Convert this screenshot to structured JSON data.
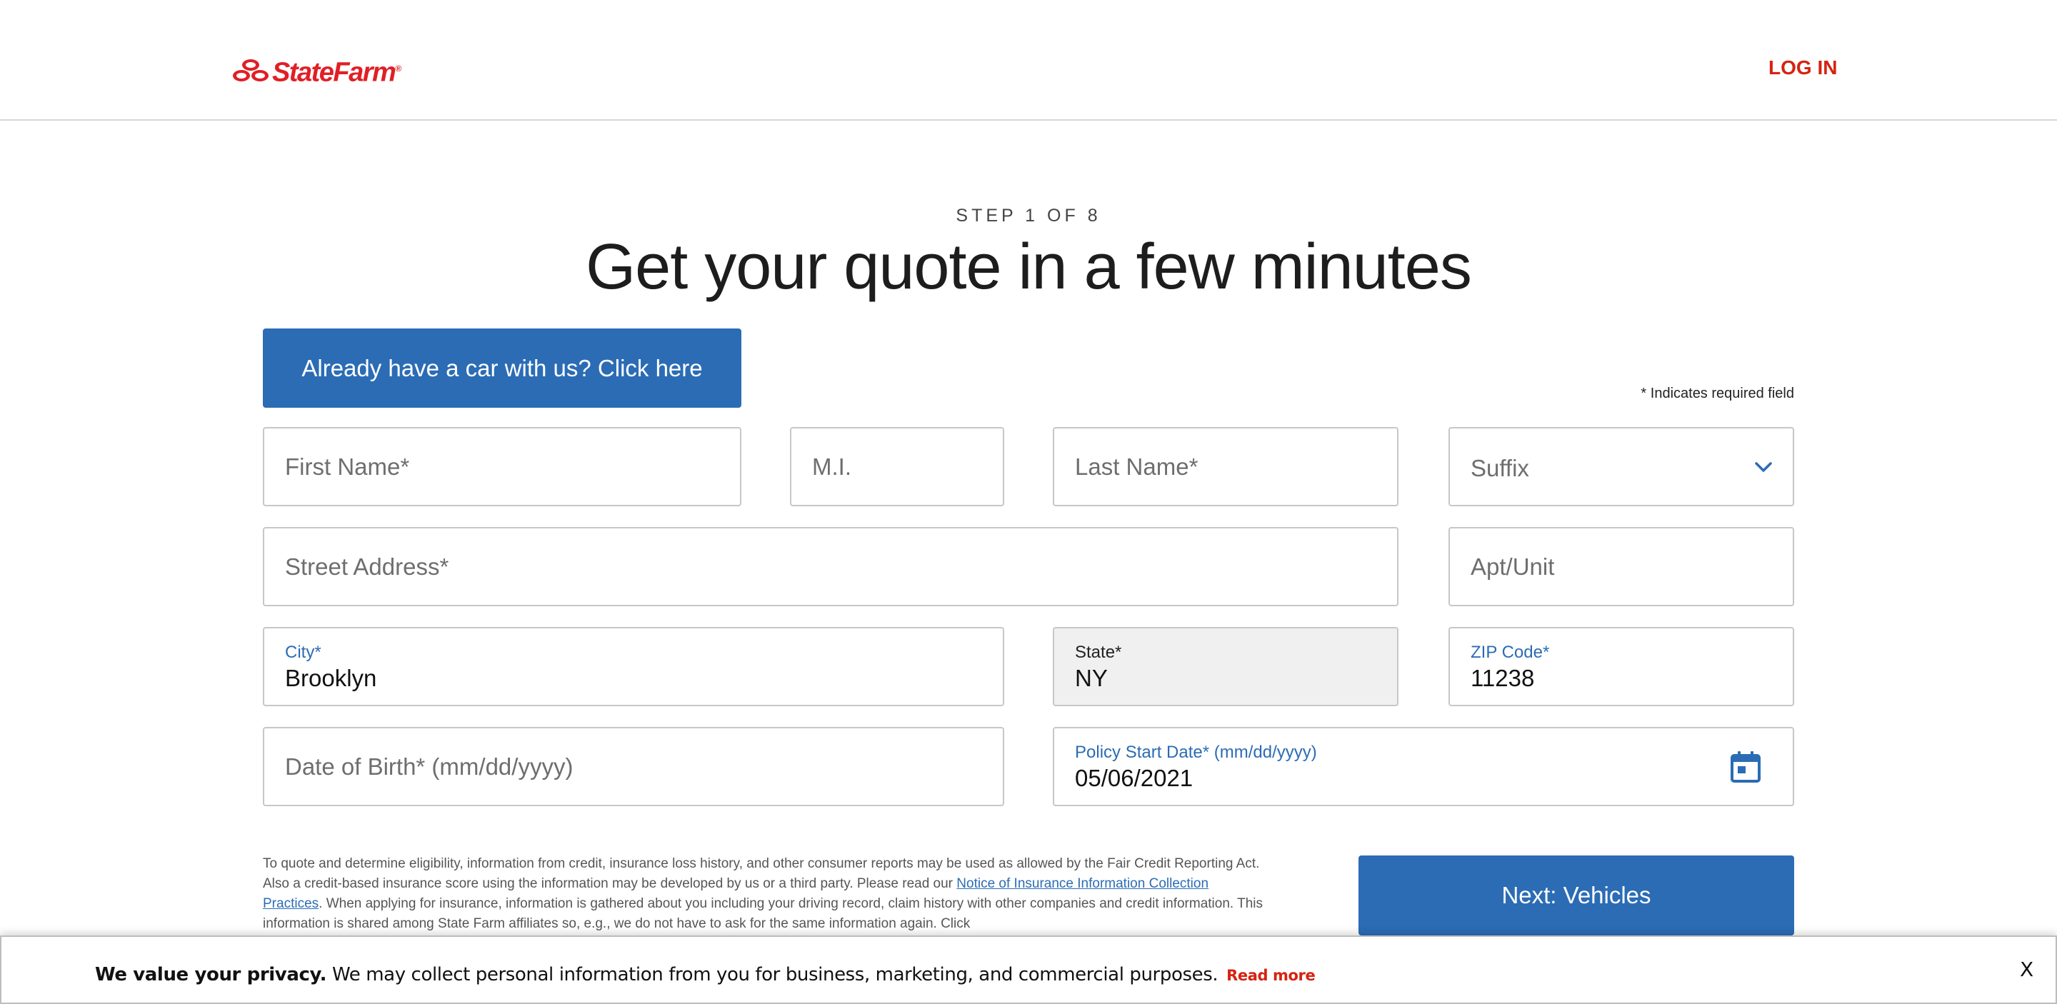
{
  "header": {
    "logo_text": "StateFarm",
    "logo_reg": "®",
    "login_label": "LOG IN"
  },
  "page": {
    "step": "STEP 1 OF 8",
    "title": "Get your quote in a few minutes",
    "existing_car_button": "Already have a car with us? Click here",
    "required_note": "* Indicates required field"
  },
  "form": {
    "first_name": {
      "placeholder": "First Name*"
    },
    "middle_initial": {
      "placeholder": "M.I."
    },
    "last_name": {
      "placeholder": "Last Name*"
    },
    "suffix": {
      "placeholder": "Suffix"
    },
    "street": {
      "placeholder": "Street Address*"
    },
    "apt": {
      "placeholder": "Apt/Unit"
    },
    "city": {
      "label": "City*",
      "value": "Brooklyn"
    },
    "state": {
      "label": "State*",
      "value": "NY"
    },
    "zip": {
      "label": "ZIP Code*",
      "value": "11238"
    },
    "dob": {
      "placeholder": "Date of Birth* (mm/dd/yyyy)"
    },
    "policy_start": {
      "label": "Policy Start Date* (mm/dd/yyyy)",
      "value": "05/06/2021"
    }
  },
  "disclosure": {
    "text_1": "To quote and determine eligibility, information from credit, insurance loss history, and other consumer reports may be used as allowed by the Fair Credit Reporting Act. Also a credit-based insurance score using the information may be developed by us or a third party. Please read our ",
    "link": "Notice of Insurance Information Collection Practices",
    "text_2": ". When applying for insurance, information is gathered about you including your driving record, claim history with other companies and credit information. This information is shared among State Farm affiliates so, e.g., we do not have to ask for the same information again. Click"
  },
  "next_button": "Next: Vehicles",
  "privacy": {
    "bold": "We value your privacy.",
    "text": " We may collect personal information from you for business, marketing, and commercial purposes.",
    "read_more": "Read more",
    "close": "X"
  },
  "colors": {
    "brand_red": "#e01f26",
    "primary_blue": "#2b6cb5"
  }
}
